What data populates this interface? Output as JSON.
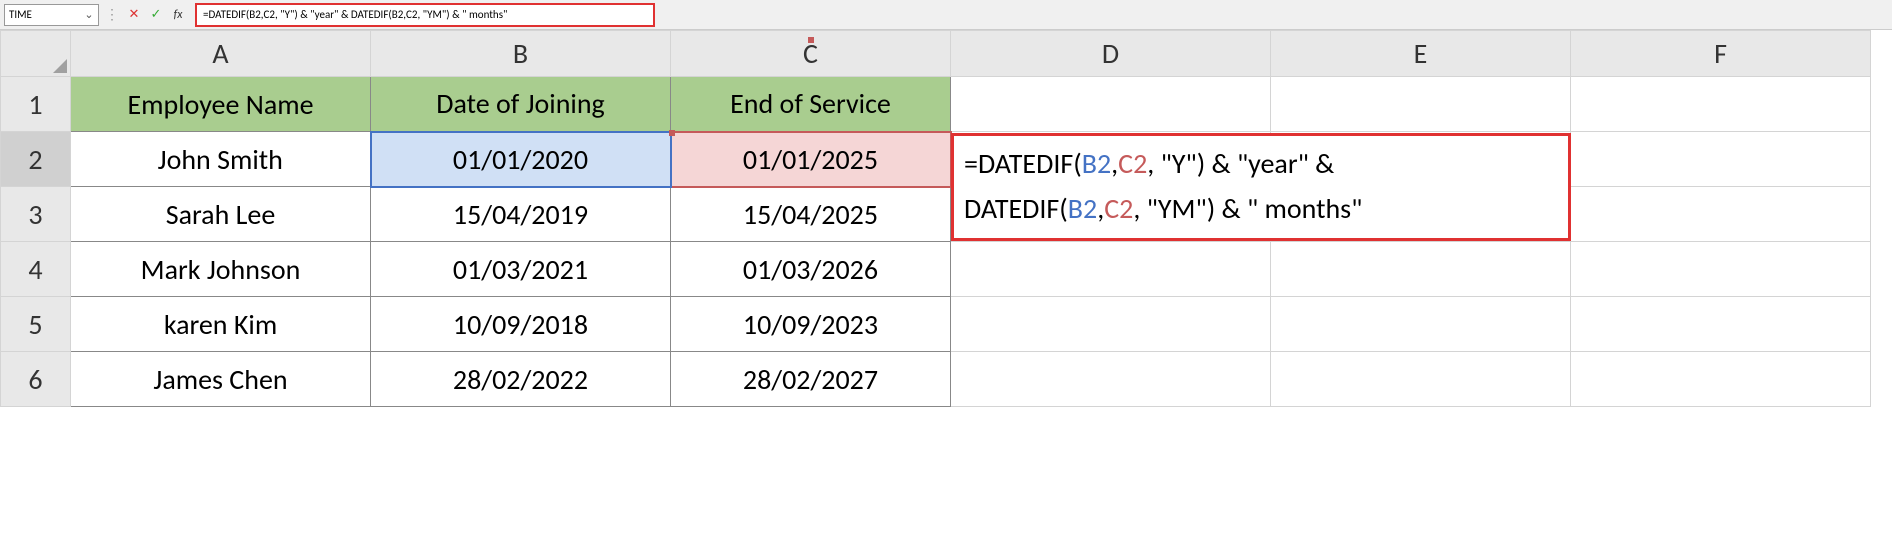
{
  "name_box": {
    "value": "TIME"
  },
  "formula_bar": {
    "value": "=DATEDIF(B2,C2, \"Y\") & \"year\" &  DATEDIF(B2,C2, \"YM\") & \" months\""
  },
  "columns": [
    "A",
    "B",
    "C",
    "D",
    "E",
    "F"
  ],
  "rows": [
    "1",
    "2",
    "3",
    "4",
    "5",
    "6"
  ],
  "headers": {
    "A": "Employee Name",
    "B": "Date of Joining",
    "C": "End of Service"
  },
  "data": [
    {
      "name": "John Smith",
      "join": "01/01/2020",
      "end": "01/01/2025"
    },
    {
      "name": "Sarah Lee",
      "join": "15/04/2019",
      "end": "15/04/2025"
    },
    {
      "name": "Mark Johnson",
      "join": "01/03/2021",
      "end": "01/03/2026"
    },
    {
      "name": "karen Kim",
      "join": "10/09/2018",
      "end": "10/09/2023"
    },
    {
      "name": "James Chen",
      "join": "28/02/2022",
      "end": "28/02/2027"
    }
  ],
  "editing_formula": {
    "prefix1": "=DATEDIF(",
    "ref1a": "B2",
    "comma1": ",",
    "ref1b": "C2",
    "mid1": ", \"Y\") & \"year\" & ",
    "prefix2": "DATEDIF(",
    "ref2a": "B2",
    "comma2": ",",
    "ref2b": "C2",
    "mid2": ", \"YM\") & \" months\""
  },
  "icons": {
    "dropdown": "⌄",
    "cancel": "✕",
    "enter": "✓",
    "fx": "fx"
  }
}
